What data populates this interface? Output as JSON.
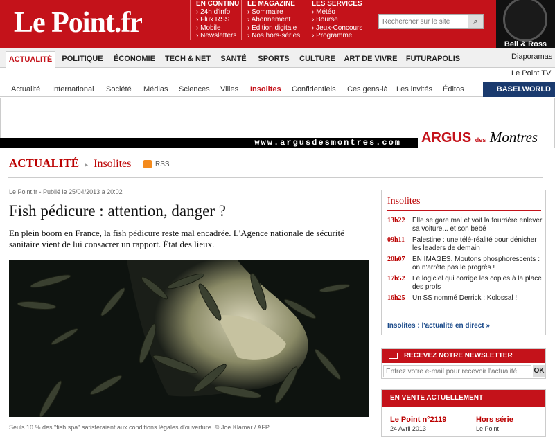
{
  "header": {
    "logo": "Le Point.fr",
    "columns": [
      {
        "title": "EN CONTINU",
        "items": [
          "24h d'info",
          "Flux RSS",
          "Mobile",
          "Newsletters"
        ]
      },
      {
        "title": "LE MAGAZINE",
        "items": [
          "Sommaire",
          "Abonnement",
          "Édition digitale",
          "Nos hors-séries"
        ]
      },
      {
        "title": "LES SERVICES",
        "items": [
          "Météo",
          "Bourse",
          "Jeux-Concours",
          "Programme"
        ]
      }
    ],
    "search_placeholder": "Rechercher sur le site",
    "ad_label": "Bell & Ross"
  },
  "nav": {
    "items": [
      "ACTUALITÉ",
      "POLITIQUE",
      "ÉCONOMIE",
      "TECH & NET",
      "SANTÉ",
      "SPORTS",
      "CULTURE",
      "ART DE VIVRE",
      "FUTURAPOLIS"
    ],
    "extra": [
      "Diaporamas",
      "Le Point TV"
    ]
  },
  "subnav": {
    "items": [
      "Actualité",
      "International",
      "Société",
      "Médias",
      "Sciences",
      "Villes",
      "Insolites",
      "Confidentiels",
      "Ces gens-là",
      "Les invités",
      "Éditos"
    ],
    "ad": "BASELWORLD"
  },
  "banner": {
    "url_text": "www.argusdesmontres.com",
    "brand_a": "ARGUS",
    "brand_b": "des",
    "brand_c": "Montres"
  },
  "breadcrumb": {
    "section": "ACTUALITÉ",
    "subsection": "Insolites",
    "rss": "RSS"
  },
  "article": {
    "meta": "Le Point.fr - Publié le 25/04/2013 à 20:02",
    "title": "Fish pédicure : attention, danger ?",
    "lede": "En plein boom en France, la fish pédicure reste mal encadrée. L'Agence nationale de sécurité sanitaire vient de lui consacrer un rapport. État des lieux.",
    "caption": "Seuls 10 % des \"fish spa\" satisferaient aux conditions légales d'ouverture. © Joe Klamar / AFP"
  },
  "sidebar": {
    "insolites_title": "Insolites",
    "items": [
      {
        "time": "13h22",
        "text": "Elle se gare mal et voit la fourrière enlever sa voiture... et son bébé"
      },
      {
        "time": "09h11",
        "text": "Palestine : une télé-réalité pour dénicher les leaders de demain"
      },
      {
        "time": "20h07",
        "text": "EN IMAGES. Moutons phosphorescents : on n'arrête pas le progrès !"
      },
      {
        "time": "17h52",
        "text": "Le logiciel qui corrige les copies à la place des profs"
      },
      {
        "time": "16h25",
        "text": "Un SS nommé Derrick : Kolossal !"
      }
    ],
    "more": "Insolites : l'actualité en direct »",
    "newsletter_title": "RECEVEZ NOTRE NEWSLETTER",
    "newsletter_placeholder": "Entrez votre e-mail pour recevoir l'actualité",
    "newsletter_ok": "OK",
    "vente_title": "EN VENTE ACTUELLEMENT",
    "vente_1_title": "Le Point n°2119",
    "vente_1_sub": "24 Avril 2013",
    "vente_2_title": "Hors série",
    "vente_2_sub": "Le Point"
  }
}
